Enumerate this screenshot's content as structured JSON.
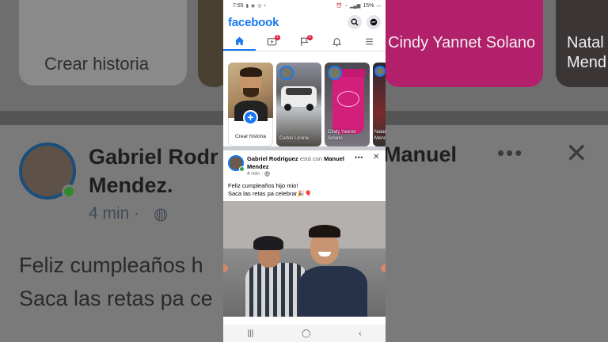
{
  "status_bar": {
    "time": "7:55",
    "left_icons": [
      "video-icon",
      "chat-icon",
      "location-icon",
      "notification-dot"
    ],
    "battery": "15%"
  },
  "app": {
    "brand": "facebook",
    "brand_color": "#1877f2",
    "search_icon": "search-icon",
    "messenger_icon": "messenger-icon"
  },
  "nav_tabs": [
    {
      "name": "home",
      "icon": "home-icon",
      "active": true,
      "badge": ""
    },
    {
      "name": "watch",
      "icon": "video-icon",
      "active": false,
      "badge": "1"
    },
    {
      "name": "pages",
      "icon": "flag-icon",
      "active": false,
      "badge": "3"
    },
    {
      "name": "notifications",
      "icon": "bell-icon",
      "active": false,
      "badge": ""
    },
    {
      "name": "menu",
      "icon": "menu-icon",
      "active": false,
      "badge": ""
    }
  ],
  "stories": {
    "create_label": "Crear historia",
    "items": [
      {
        "name": "Carlos Licona"
      },
      {
        "name": "Cindy Yannet Solano"
      },
      {
        "name": "Natal Mend"
      }
    ]
  },
  "post": {
    "author": "Gabriel Rodríguez",
    "with_text": "está con",
    "tagged": "Manuel Mendez",
    "time": "4 min",
    "privacy_icon": "globe-icon",
    "text_line1": "Feliz cumpleaños hijo mio!",
    "text_line2": "Saca las retas pa celebrar🎉🎈"
  },
  "background_zoom": {
    "create_label": "Crear historia",
    "story_name": "Cindy Yannet Solano",
    "story_name_2": "Natal Mend",
    "author": "Gabriel Rodr",
    "tagged_fragment": "Manuel",
    "tagged_line2": "Mendez.",
    "time": "4 min ·",
    "text_line1": "Feliz cumpleaños h",
    "text_line2": "Saca las retas pa ce"
  }
}
